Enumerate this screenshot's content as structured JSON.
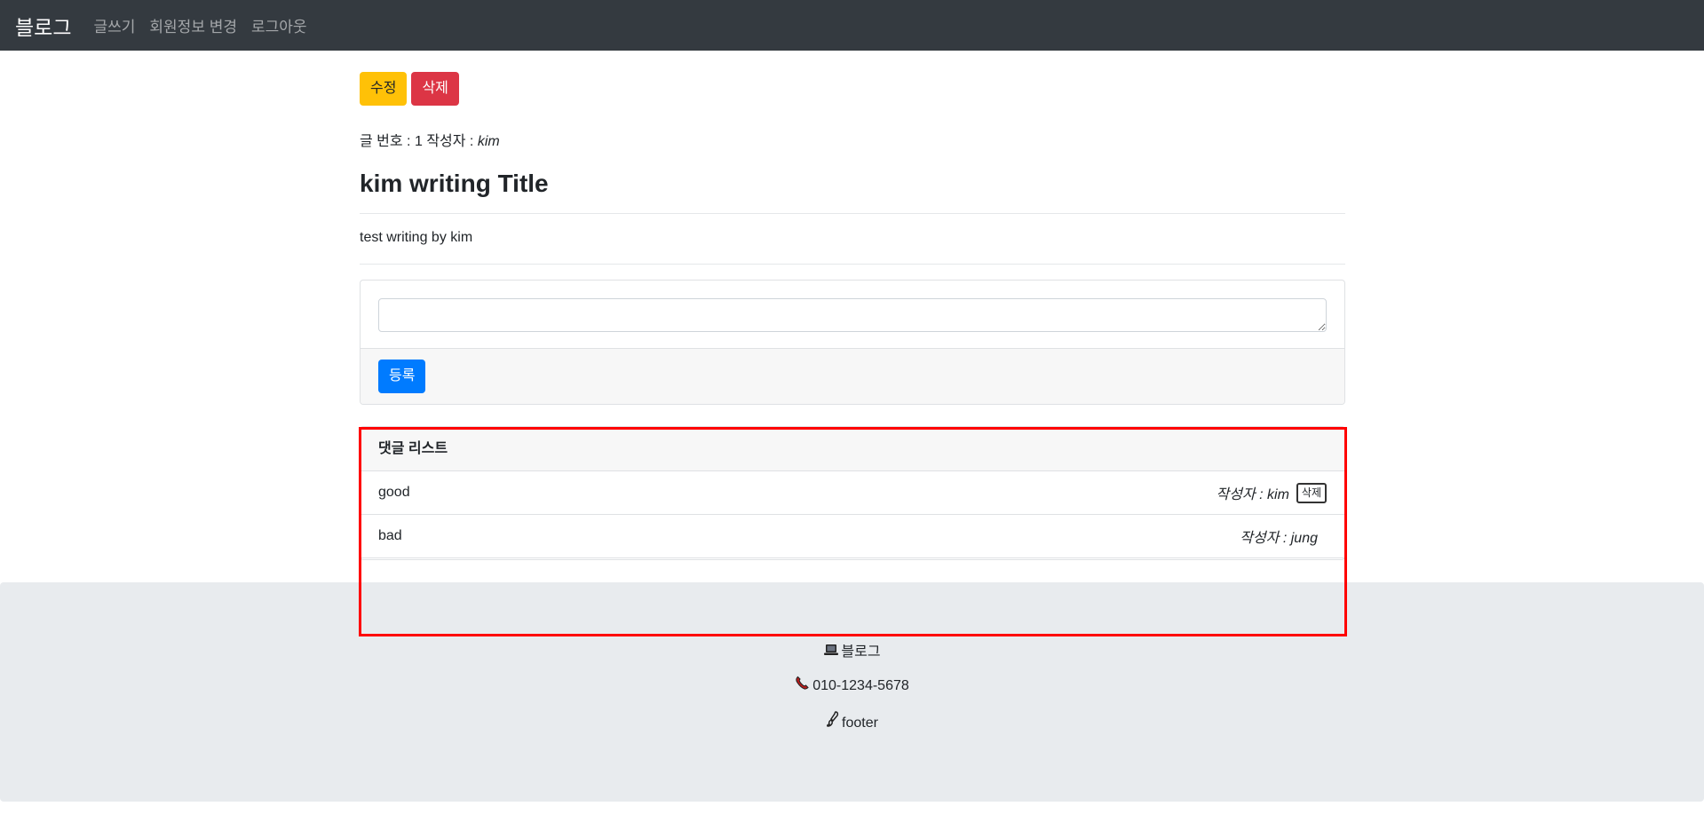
{
  "navbar": {
    "brand": "블로그",
    "links": [
      "글쓰기",
      "회원정보 변경",
      "로그아웃"
    ]
  },
  "post": {
    "edit_label": "수정",
    "delete_label": "삭제",
    "number_label": "글 번호 :",
    "number": "1",
    "author_label": "작성자 :",
    "author": "kim",
    "title": "kim writing Title",
    "content": "test writing by kim"
  },
  "reply_form": {
    "textarea_value": "",
    "submit_label": "등록"
  },
  "comments": {
    "header": "댓글 리스트",
    "items": [
      {
        "content": "good",
        "author": "작성자 : kim",
        "delete_label": "삭제"
      },
      {
        "content": "bad",
        "author": "작성자 : jung"
      }
    ]
  },
  "footer": {
    "lines": [
      {
        "icon": "laptop-icon",
        "text": "블로그"
      },
      {
        "icon": "phone-icon",
        "text": "010-1234-5678"
      },
      {
        "icon": "brush-icon",
        "text": "footer"
      }
    ]
  },
  "colors": {
    "navbar_bg": "#343a40",
    "warning": "#ffc107",
    "danger": "#dc3545",
    "primary": "#007bff",
    "footer_bg": "#e8ebee",
    "highlight_outline": "#ff0000"
  }
}
